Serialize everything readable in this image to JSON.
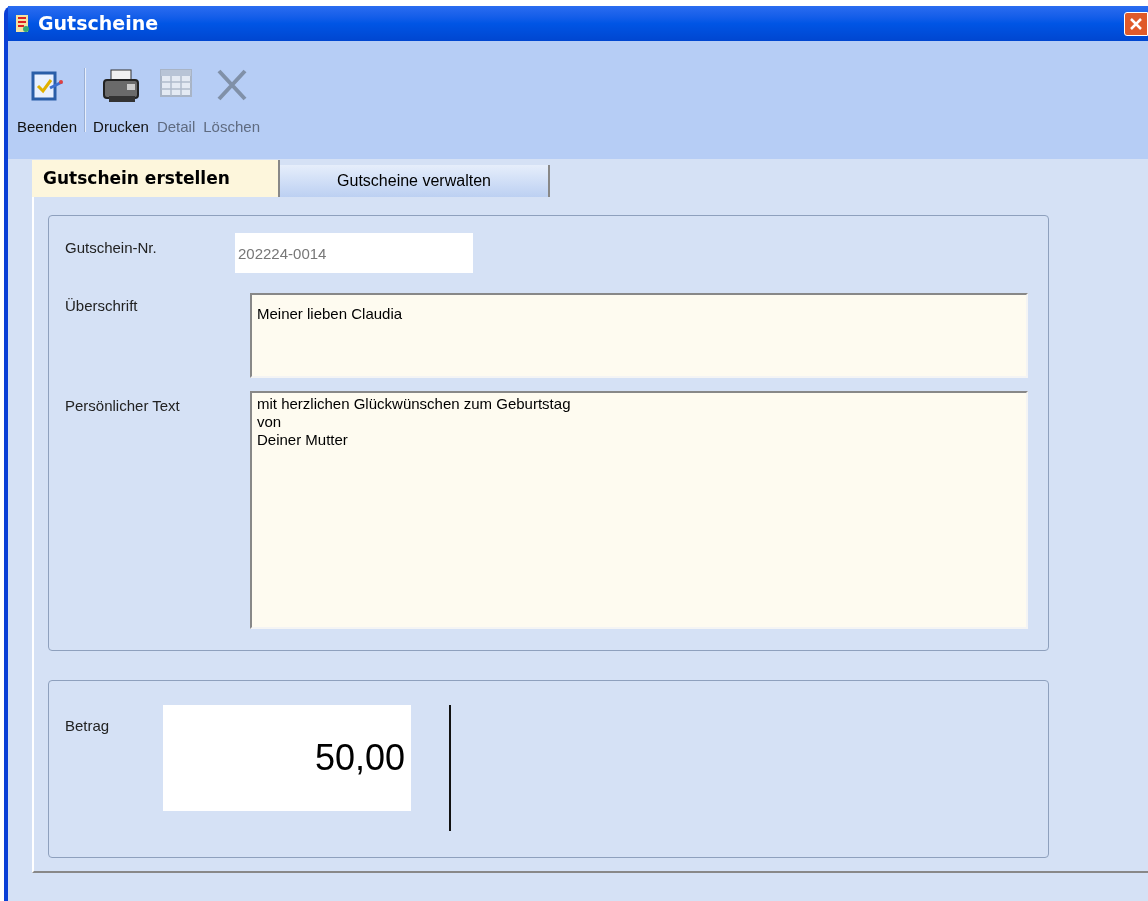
{
  "window": {
    "title": "Gutscheine"
  },
  "toolbar": [
    {
      "label": "Beenden",
      "disabled": false
    },
    {
      "label": "Drucken",
      "disabled": false
    },
    {
      "label": "Detail",
      "disabled": true
    },
    {
      "label": "Löschen",
      "disabled": true
    }
  ],
  "tabs": [
    {
      "label": "Gutschein erstellen",
      "selected": true
    },
    {
      "label": "Gutscheine verwalten",
      "selected": false
    }
  ],
  "form": {
    "voucher_number": {
      "label": "Gutschein-Nr.",
      "value": "202224-0014",
      "disabled": true
    },
    "heading": {
      "label": "Überschrift",
      "value": "Meiner lieben Claudia"
    },
    "personal_text": {
      "label": "Persönlicher Text",
      "value": "mit herzlichen Glückwünschen zum Geburtstag\nvon\nDeiner Mutter"
    }
  },
  "amount": {
    "label": "Betrag",
    "value": "50,00"
  }
}
